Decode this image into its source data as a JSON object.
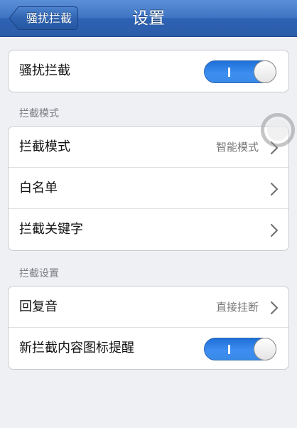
{
  "navbar": {
    "back_label": "骚扰拦截",
    "title": "设置"
  },
  "group1": {
    "rows": [
      {
        "label": "骚扰拦截",
        "toggle_on": true
      }
    ]
  },
  "section_mode": {
    "header": "拦截模式",
    "rows": [
      {
        "label": "拦截模式",
        "value": "智能模式"
      },
      {
        "label": "白名单"
      },
      {
        "label": "拦截关键字"
      }
    ]
  },
  "section_settings": {
    "header": "拦截设置",
    "rows": [
      {
        "label": "回复音",
        "value": "直接挂断"
      },
      {
        "label": "新拦截内容图标提醒",
        "toggle_on": true
      }
    ]
  },
  "colors": {
    "navbar": "#3f75c4",
    "toggle_on": "#3d8ef0",
    "background": "#eff0f4"
  },
  "icons": {
    "chevron": "chevron-right-icon"
  }
}
